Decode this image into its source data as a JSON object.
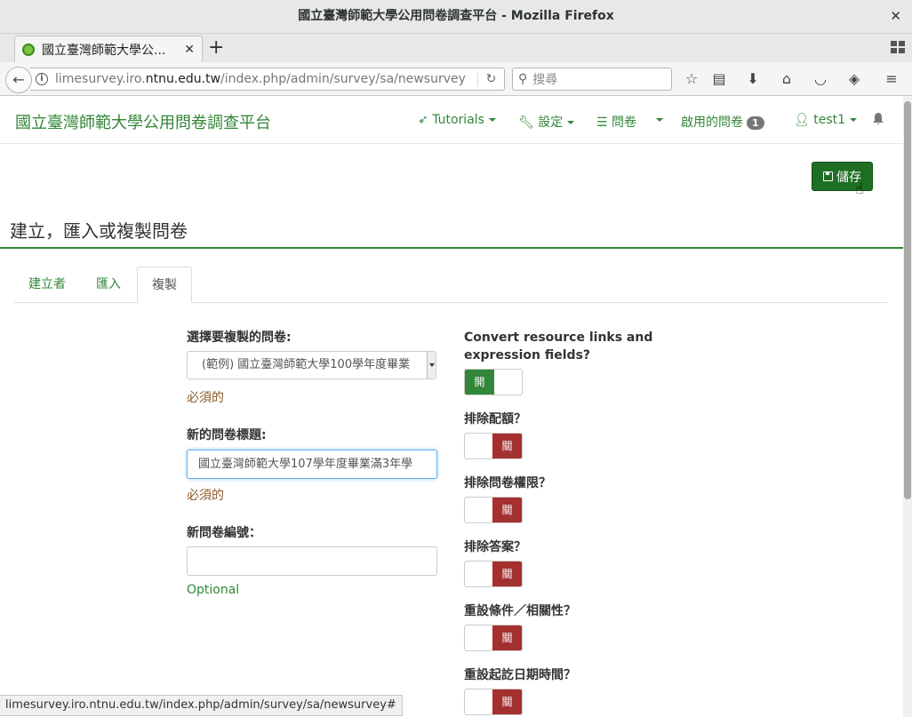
{
  "window": {
    "title": "國立臺灣師範大學公用問卷調查平台 - Mozilla Firefox"
  },
  "browser": {
    "tab_title": "國立臺灣師範大學公...",
    "url_pre": "limesurvey.iro.",
    "url_domain": "ntnu.edu.tw",
    "url_post": "/index.php/admin/survey/sa/newsurvey",
    "search_placeholder": "搜尋",
    "status_url": "limesurvey.iro.ntnu.edu.tw/index.php/admin/survey/sa/newsurvey#"
  },
  "app": {
    "brand": "國立臺灣師範大學公用問卷調查平台",
    "menu": {
      "tutorials": "Tutorials",
      "settings": "設定",
      "surveys": "問卷",
      "active_surveys": "啟用的問卷",
      "active_count": "1",
      "user": "test1"
    },
    "save_label": "儲存",
    "page_title": "建立，匯入或複製問卷",
    "tabs": [
      "建立者",
      "匯入",
      "複製"
    ]
  },
  "form": {
    "copy_survey_label": "選擇要複製的問卷:",
    "copy_survey_value": "(範例) 國立臺灣師範大學100學年度畢業",
    "required_1": "必須的",
    "new_title_label": "新的問卷標題:",
    "new_title_value": "國立臺灣師範大學107學年度畢業滿3年學",
    "required_2": "必須的",
    "new_id_label": "新問卷編號：",
    "new_id_value": "",
    "optional": "Optional",
    "options": [
      {
        "label": "Convert resource links and expression fields?",
        "state": "開"
      },
      {
        "label": "排除配額？",
        "state": "關"
      },
      {
        "label": "排除問卷權限？",
        "state": "關"
      },
      {
        "label": "排除答案？",
        "state": "關"
      },
      {
        "label": "重設條件／相關性？",
        "state": "關"
      },
      {
        "label": "重設起訖日期時間？",
        "state": "關"
      }
    ]
  },
  "colors": {
    "accent": "#328637",
    "off": "#a4302f",
    "save": "#1e6e23"
  }
}
